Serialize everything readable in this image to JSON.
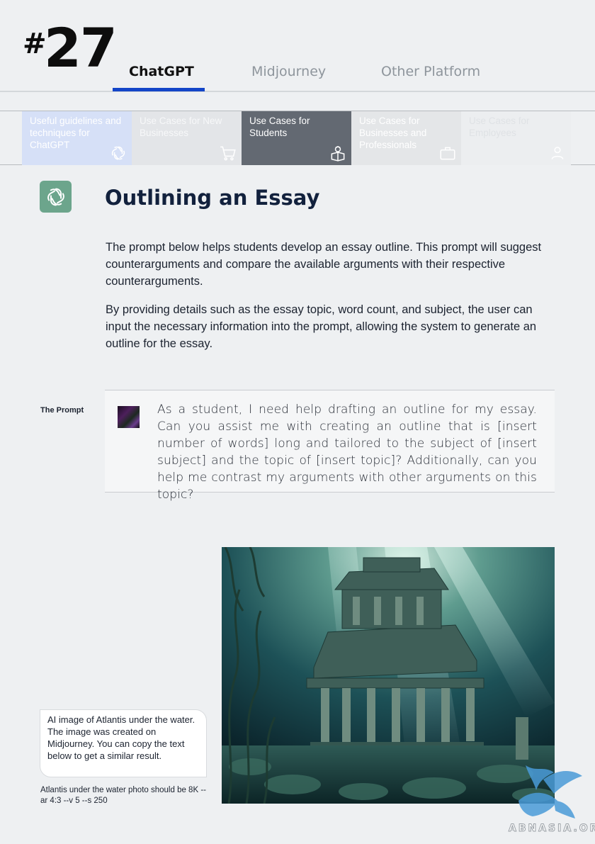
{
  "header": {
    "page_hash": "#",
    "page_number": "27",
    "tabs": [
      {
        "label": "ChatGPT",
        "active": true
      },
      {
        "label": "Midjourney",
        "active": false
      },
      {
        "label": "Other Platform",
        "active": false
      }
    ],
    "accent_color": "#1345c8"
  },
  "categories": [
    {
      "label": "Useful guidelines and techniques for ChatGPT",
      "icon": "chatgpt-logo-icon"
    },
    {
      "label": "Use Cases for New Businesses",
      "icon": "shopping-cart-icon"
    },
    {
      "label": "Use Cases for Students",
      "icon": "student-icon",
      "active": true
    },
    {
      "label": "Use Cases for Businesses and Professionals",
      "icon": "briefcase-icon"
    },
    {
      "label": "Use Cases for Employees",
      "icon": "employee-icon"
    }
  ],
  "section": {
    "title": "Outlining an Essay",
    "icon": "chatgpt-logo-icon",
    "paragraph1": "The prompt below helps students develop an essay outline. This prompt will suggest counterarguments and compare the available arguments with their respective counterarguments.",
    "paragraph2": "By providing details such as the essay topic, word count, and subject, the user can input the necessary information into the prompt, allowing the system to generate an outline for the essay."
  },
  "prompt": {
    "label": "The Prompt",
    "text": "As a student, I need help drafting an outline for my essay. Can you assist me with creating an outline that is [insert number of words] long and tailored to the subject of [insert subject] and the topic of [insert topic]? Additionally, can you help me contrast my arguments with other arguments on this topic?"
  },
  "image_caption": {
    "text": "AI image of Atlantis under the water. The image was created on Midjourney. You can copy the text below to get a similar result.",
    "prompt": "Atlantis under the water photo should be 8K --ar 4:3 --v 5 --s 250"
  },
  "watermark": {
    "text": "ABNASIA.ORG"
  }
}
